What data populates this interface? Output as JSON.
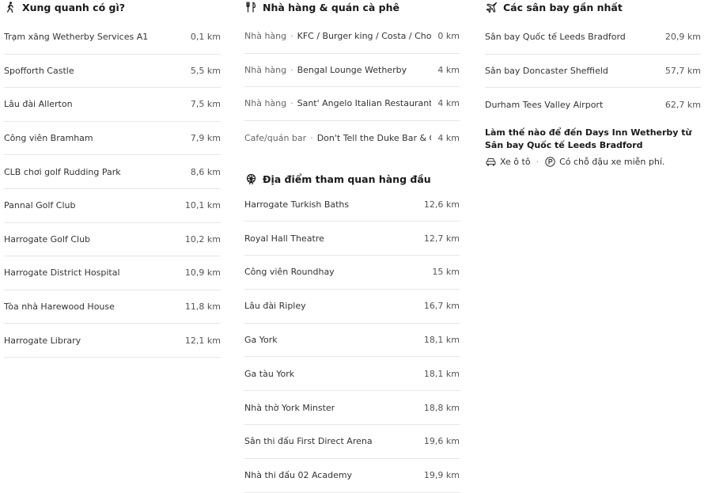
{
  "nearby": {
    "title": "Xung quanh có gì?",
    "icon": "person-walking-icon",
    "items": [
      {
        "name": "Trạm xăng Wetherby Services A1",
        "distance": "0,1 km"
      },
      {
        "name": "Spofforth Castle",
        "distance": "5,5 km"
      },
      {
        "name": "Lâu đài Allerton",
        "distance": "7,5 km"
      },
      {
        "name": "Công viên Bramham",
        "distance": "7,9 km"
      },
      {
        "name": "CLB chơi golf Rudding Park",
        "distance": "8,6 km"
      },
      {
        "name": "Pannal Golf Club",
        "distance": "10,1 km"
      },
      {
        "name": "Harrogate Golf Club",
        "distance": "10,2 km"
      },
      {
        "name": "Harrogate District Hospital",
        "distance": "10,9 km"
      },
      {
        "name": "Tòa nhà Harewood House",
        "distance": "11,8 km"
      },
      {
        "name": "Harrogate Library",
        "distance": "12,1 km"
      }
    ]
  },
  "dining": {
    "title": "Nhà hàng & quán cà phê",
    "icon": "fork-knife-icon",
    "items": [
      {
        "category": "Nhà hàng",
        "name": "KFC / Burger king / Costa / Chow",
        "distance": "0 km"
      },
      {
        "category": "Nhà hàng",
        "name": "Bengal Lounge Wetherby",
        "distance": "4 km"
      },
      {
        "category": "Nhà hàng",
        "name": "Sant' Angelo Italian Restaurant",
        "distance": "4 km"
      },
      {
        "category": "Cafe/quán bar",
        "name": "Don't Tell the Duke Bar & Grill",
        "distance": "4 km"
      }
    ]
  },
  "attractions": {
    "title": "Địa điểm tham quan hàng đầu",
    "icon": "ferris-wheel-icon",
    "items": [
      {
        "name": "Harrogate Turkish Baths",
        "distance": "12,6 km"
      },
      {
        "name": "Royal Hall Theatre",
        "distance": "12,7 km"
      },
      {
        "name": "Công viên Roundhay",
        "distance": "15 km"
      },
      {
        "name": "Lâu đài Ripley",
        "distance": "16,7 km"
      },
      {
        "name": "Ga York",
        "distance": "18,1 km"
      },
      {
        "name": "Ga tàu York",
        "distance": "18,1 km"
      },
      {
        "name": "Nhà thờ York Minster",
        "distance": "18,8 km"
      },
      {
        "name": "Sân thi đấu First Direct Arena",
        "distance": "19,6 km"
      },
      {
        "name": "Nhà thi đấu 02 Academy",
        "distance": "19,9 km"
      }
    ]
  },
  "airports": {
    "title": "Các sân bay gần nhất",
    "icon": "airplane-icon",
    "items": [
      {
        "name": "Sân bay Quốc tế Leeds Bradford",
        "distance": "20,9 km"
      },
      {
        "name": "Sân bay Doncaster Sheffield",
        "distance": "57,7 km"
      },
      {
        "name": "Durham Tees Valley Airport",
        "distance": "62,7 km"
      }
    ],
    "howto_title": "Làm thế nào để đến Days Inn Wetherby từ Sân bay Quốc tế Leeds Bradford",
    "transport": {
      "car_label": "Xe ô tô",
      "separator": "·",
      "parking_label": "Có chỗ đậu xe miễn phí."
    }
  },
  "ui": {
    "dot_separator": "·"
  }
}
